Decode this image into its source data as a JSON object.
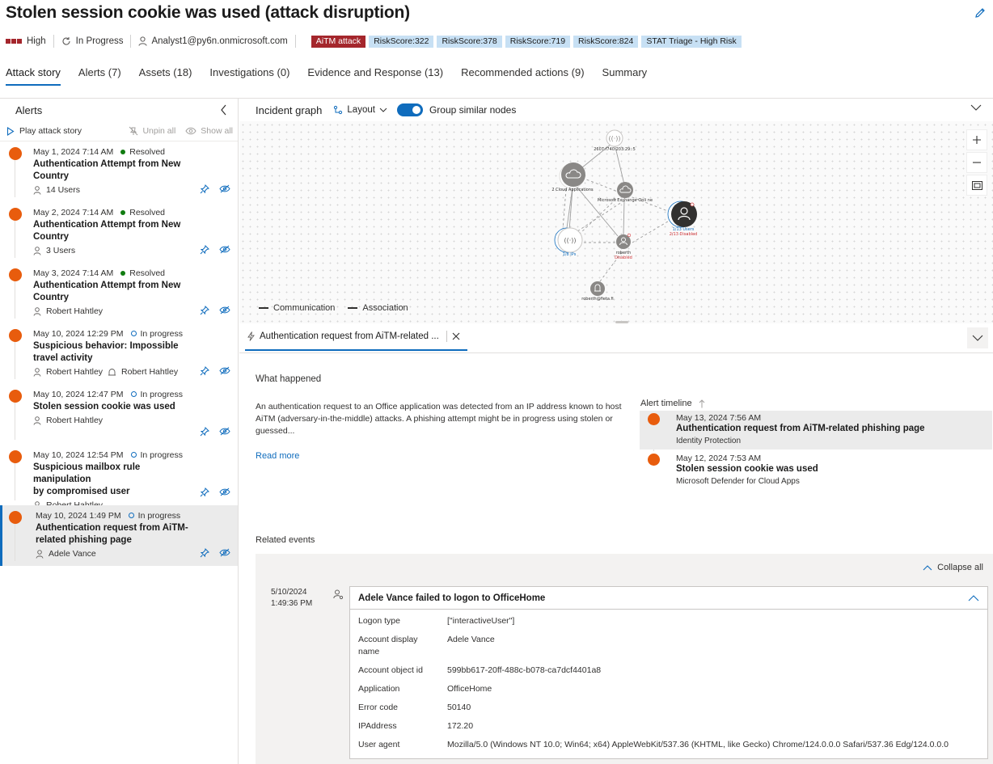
{
  "header": {
    "title": "Stolen session cookie was used (attack disruption)",
    "severity": "High",
    "status": "In Progress",
    "assignee": "Analyst1@py6n.onmicrosoft.com",
    "tags": [
      "AiTM attack",
      "RiskScore:322",
      "RiskScore:378",
      "RiskScore:719",
      "RiskScore:824",
      "STAT Triage - High Risk"
    ],
    "severity_color": "#a4262c",
    "accent_color": "#0f6cbd"
  },
  "tabs": [
    {
      "label": "Attack story",
      "active": true
    },
    {
      "label": "Alerts (7)"
    },
    {
      "label": "Assets (18)"
    },
    {
      "label": "Investigations (0)"
    },
    {
      "label": "Evidence and Response (13)"
    },
    {
      "label": "Recommended actions (9)"
    },
    {
      "label": "Summary"
    }
  ],
  "alerts_panel": {
    "title": "Alerts",
    "play_label": "Play attack story",
    "unpin_label": "Unpin all",
    "show_label": "Show all",
    "alert_color": "#e85c0d",
    "items": [
      {
        "date": "May 1, 2024 7:14 AM",
        "status": "Resolved",
        "title_lines": [
          "Authentication Attempt from New",
          "Country"
        ],
        "users": [
          "14 Users"
        ]
      },
      {
        "date": "May 2, 2024 7:14 AM",
        "status": "Resolved",
        "title_lines": [
          "Authentication Attempt from New",
          "Country"
        ],
        "users": [
          "3 Users"
        ]
      },
      {
        "date": "May 3, 2024 7:14 AM",
        "status": "Resolved",
        "title_lines": [
          "Authentication Attempt from New",
          "Country"
        ],
        "users": [
          "Robert Hahtley"
        ]
      },
      {
        "date": "May 10, 2024 12:29 PM",
        "status": "In progress",
        "title_lines": [
          "Suspicious behavior: Impossible",
          "travel activity"
        ],
        "users": [
          "Robert Hahtley",
          "Robert Hahtley"
        ]
      },
      {
        "date": "May 10, 2024 12:47 PM",
        "status": "In progress",
        "title_lines": [
          "Stolen session cookie was used"
        ],
        "users": [
          "Robert Hahtley"
        ]
      },
      {
        "date": "May 10, 2024 12:54 PM",
        "status": "In progress",
        "title_lines": [
          "Suspicious mailbox rule manipulation",
          "by compromised user"
        ],
        "users": [
          "Robert Hahtley"
        ]
      },
      {
        "date": "May 10, 2024 1:49 PM",
        "status": "In progress",
        "title_lines": [
          "Authentication request from AiTM-",
          "related phishing page"
        ],
        "users": [
          "Adele Vance"
        ],
        "selected": true
      }
    ]
  },
  "graph": {
    "title": "Incident graph",
    "layout_label": "Layout",
    "group_label": "Group similar nodes",
    "group_enabled": true,
    "nodes": {
      "ip_top": "2607:f740:203:29::5",
      "cloud_apps": "2 Cloud Applications",
      "exchange": "Microsoft Exchange Onli ne",
      "users": "1/13 Users",
      "users_disabled": "2/13 Disabled",
      "ips": "1/8 IPs",
      "roberth": "roberth",
      "roberth_disabled": "Disabled",
      "mailbox": "roberth@fieta.fi"
    },
    "legend": {
      "communication": "Communication",
      "association": "Association"
    }
  },
  "detail": {
    "tab_label": "Authentication request from AiTM-related ...",
    "what_happened_title": "What happened",
    "what_happened_text": "An authentication request to an Office application was detected from an IP address known to host AiTM (adversary-in-the-middle) attacks. A phishing attempt might be in progress using stolen or guessed...",
    "read_more": "Read more",
    "timeline_title": "Alert timeline",
    "timeline": [
      {
        "date": "May 13, 2024 7:56 AM",
        "title": "Authentication request from AiTM-related phishing page",
        "source": "Identity Protection",
        "selected": true
      },
      {
        "date": "May 12, 2024 7:53 AM",
        "title": "Stolen session cookie was used",
        "source": "Microsoft Defender for Cloud Apps"
      }
    ],
    "related_events_title": "Related events",
    "collapse_all": "Collapse all",
    "event": {
      "date": "5/10/2024",
      "time": "1:49:36 PM",
      "title": "Adele Vance failed to logon to OfficeHome",
      "rows": [
        {
          "key": [
            "Logon type"
          ],
          "value": "[\"interactiveUser\"]"
        },
        {
          "key": [
            "Account display",
            "name"
          ],
          "value": "Adele Vance"
        },
        {
          "key": [
            "Account object id"
          ],
          "value": "599bb617-20ff-488c-b078-ca7dcf4401a8"
        },
        {
          "key": [
            "Application"
          ],
          "value": "OfficeHome"
        },
        {
          "key": [
            "Error code"
          ],
          "value": "50140"
        },
        {
          "key": [
            "IPAddress"
          ],
          "value": "172.20"
        },
        {
          "key": [
            "User agent"
          ],
          "value": "Mozilla/5.0 (Windows NT 10.0; Win64; x64) AppleWebKit/537.36 (KHTML, like Gecko) Chrome/124.0.0.0 Safari/537.36 Edg/124.0.0.0"
        }
      ]
    }
  }
}
